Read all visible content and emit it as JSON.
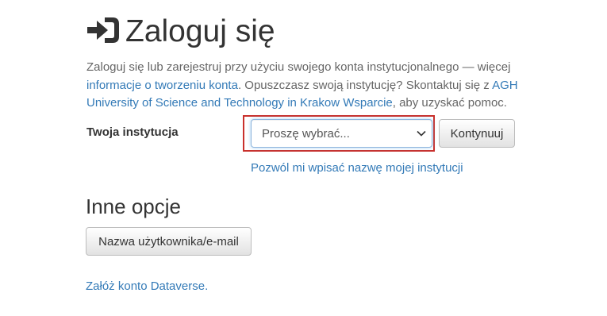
{
  "page": {
    "title": "Zaloguj się"
  },
  "intro": {
    "text_before_link": "Zaloguj się lub zarejestruj przy użyciu swojego konta instytucjonalnego — więcej ",
    "link_info": "informacje o tworzeniu konta",
    "text_middle": ". Opuszczasz swoją instytucję? Skontaktuj się z ",
    "link_support": "AGH University of Science and Technology in Krakow Wsparcie",
    "text_after": ", aby uzyskać pomoc."
  },
  "institution": {
    "label": "Twoja instytucja",
    "selected": "Proszę wybrać...",
    "continue_label": "Kontynuuj",
    "manual_link": "Pozwól mi wpisać nazwę mojej instytucji",
    "highlight_color": "#c9302c"
  },
  "other_options": {
    "heading": "Inne opcje",
    "username_button": "Nazwa użytkownika/e-mail",
    "signup_link": "Załóż konto Dataverse."
  },
  "icons": {
    "login": "sign-in-icon",
    "select_arrow": "chevron-down-icon"
  },
  "colors": {
    "link": "#337ab7",
    "text": "#333333",
    "muted": "#666666"
  }
}
